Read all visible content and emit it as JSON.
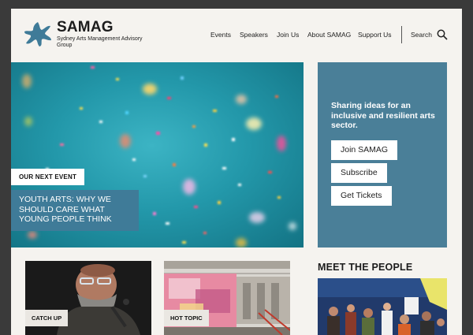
{
  "brand": {
    "name": "SAMAG",
    "subtitle": "Sydney Arts Management Advisory Group",
    "color": "#3f7b98"
  },
  "nav": {
    "items": [
      "Events",
      "Speakers",
      "Join Us",
      "About SAMAG",
      "Support Us"
    ],
    "search_label": "Search"
  },
  "hero": {
    "tag": "OUR NEXT EVENT",
    "title": "YOUTH ARTS: WHY WE SHOULD CARE WHAT YOUNG PEOPLE THINK"
  },
  "promo": {
    "heading": "Sharing ideas for an inclusive and resilient arts sector.",
    "buttons": [
      "Join SAMAG",
      "Subscribe",
      "Get Tickets"
    ],
    "color": "#4a7f98"
  },
  "cards": [
    {
      "tag": "CATCH UP"
    },
    {
      "tag": "HOT TOPIC"
    }
  ],
  "meet": {
    "heading": "MEET THE PEOPLE"
  },
  "icons": [
    "samag-logo-icon",
    "search-icon"
  ]
}
